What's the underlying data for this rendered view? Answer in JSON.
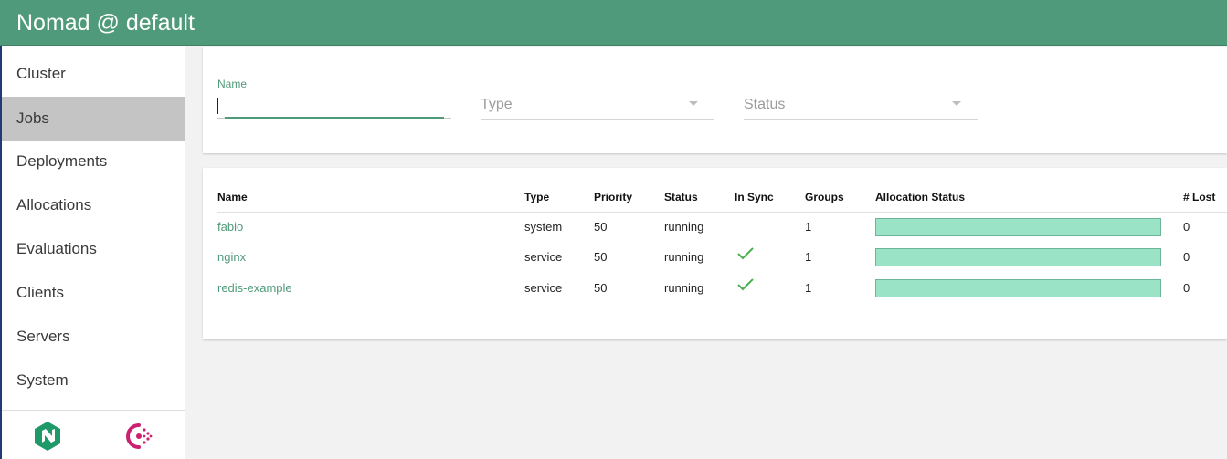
{
  "header": {
    "title": "Nomad @ default"
  },
  "sidebar": {
    "items": [
      {
        "label": "Cluster"
      },
      {
        "label": "Jobs"
      },
      {
        "label": "Deployments"
      },
      {
        "label": "Allocations"
      },
      {
        "label": "Evaluations"
      },
      {
        "label": "Clients"
      },
      {
        "label": "Servers"
      },
      {
        "label": "System"
      }
    ],
    "active_item": "Jobs"
  },
  "filters": {
    "name_label": "Name",
    "name_value": "",
    "type_placeholder": "Type",
    "status_placeholder": "Status"
  },
  "jobs_table": {
    "columns": [
      "Name",
      "Type",
      "Priority",
      "Status",
      "In Sync",
      "Groups",
      "Allocation Status",
      "# Lost"
    ],
    "rows": [
      {
        "name": "fabio",
        "type": "system",
        "priority": "50",
        "status": "running",
        "in_sync": false,
        "groups": "1",
        "allocation_running_fraction": 1.0,
        "lost": "0"
      },
      {
        "name": "nginx",
        "type": "service",
        "priority": "50",
        "status": "running",
        "in_sync": true,
        "groups": "1",
        "allocation_running_fraction": 1.0,
        "lost": "0"
      },
      {
        "name": "redis-example",
        "type": "service",
        "priority": "50",
        "status": "running",
        "in_sync": true,
        "groups": "1",
        "allocation_running_fraction": 1.0,
        "lost": "0"
      }
    ]
  },
  "colors": {
    "brand": "#4f9a7a",
    "allocation_running": "#9ae3c6",
    "sync_check": "#4caf50",
    "consul_logo": "#ca2171",
    "nomad_logo": "#1f9967"
  },
  "icons": {
    "in_sync": "checkmark-icon",
    "select_arrow": "chevron-down-icon",
    "nomad_logo": "nomad-logo-icon",
    "consul_logo": "consul-logo-icon"
  }
}
